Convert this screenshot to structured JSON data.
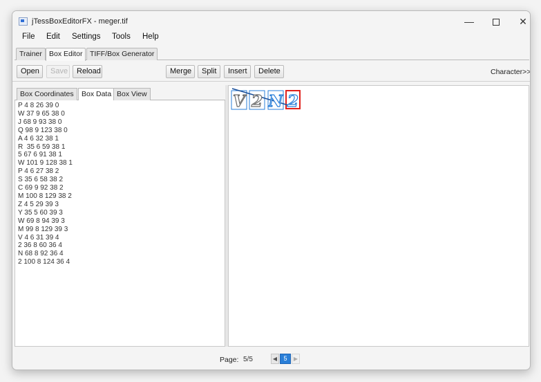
{
  "window": {
    "title": "jTessBoxEditorFX - meger.tif",
    "controls": {
      "minimize": "—",
      "close": "✕"
    }
  },
  "menu": [
    "File",
    "Edit",
    "Settings",
    "Tools",
    "Help"
  ],
  "main_tabs": [
    "Trainer",
    "Box Editor",
    "TIFF/Box Generator"
  ],
  "main_tab_active": "Box Editor",
  "toolbar": {
    "open": "Open",
    "save": "Save",
    "reload": "Reload",
    "merge": "Merge",
    "split": "Split",
    "insert": "Insert",
    "delete": "Delete",
    "character": "Character>>"
  },
  "sub_tabs": [
    "Box Coordinates",
    "Box Data",
    "Box View"
  ],
  "sub_tab_active": "Box Data",
  "box_data": [
    "P 4 8 26 39 0",
    "W 37 9 65 38 0",
    "J 68 9 93 38 0",
    "Q 98 9 123 38 0",
    "A 4 6 32 38 1",
    "R  35 6 59 38 1",
    "5 67 6 91 38 1",
    "W 101 9 128 38 1",
    "P 4 6 27 38 2",
    "S 35 6 58 38 2",
    "C 69 9 92 38 2",
    "M 100 8 129 38 2",
    "Z 4 5 29 39 3",
    "Y 35 5 60 39 3",
    "W 69 8 94 39 3",
    "M 99 8 129 39 3",
    "V 4 6 31 39 4",
    "2 36 8 60 36 4",
    "N 68 8 92 36 4",
    "2 100 8 124 36 4"
  ],
  "glyphs": [
    "V",
    "2",
    "N",
    "2"
  ],
  "colors": {
    "selected_box": "#e0201b",
    "box_outline": "#2a7fd8",
    "page_active": "#2a7fd8"
  },
  "footer": {
    "page_label": "Page:",
    "page_count": "5/5",
    "current_page": "5",
    "prev": "◀",
    "next": "▶"
  }
}
